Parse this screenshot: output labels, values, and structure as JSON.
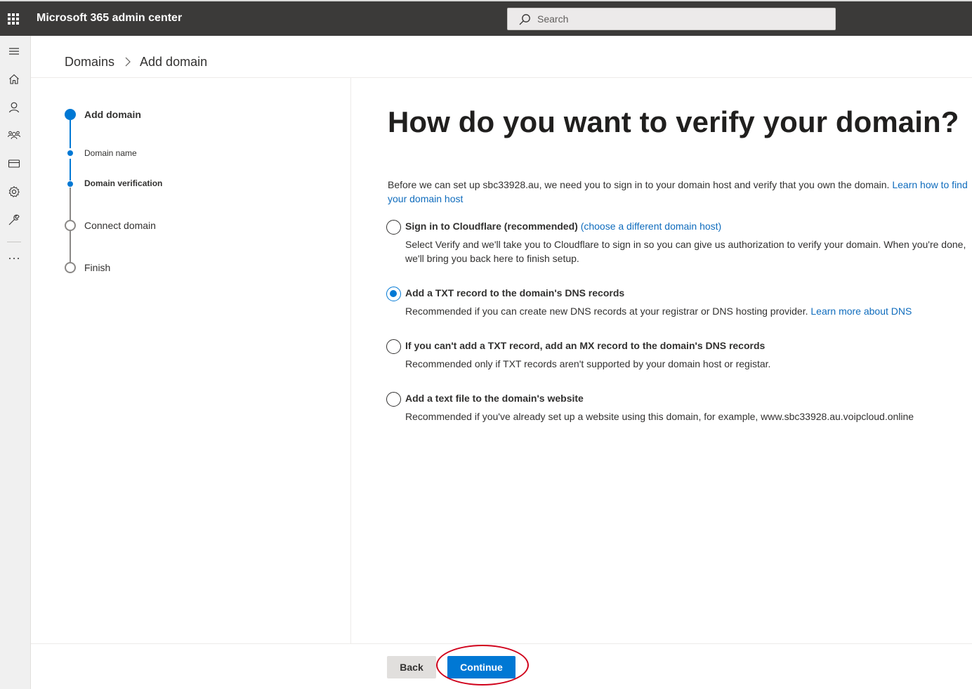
{
  "header": {
    "app_title": "Microsoft 365 admin center",
    "search_placeholder": "Search"
  },
  "leftnav": {
    "icons": [
      "menu-icon",
      "home-icon",
      "user-icon",
      "group-icon",
      "billing-icon",
      "settings-icon",
      "setup-icon",
      "more-icon"
    ]
  },
  "breadcrumb": {
    "parent": "Domains",
    "current": "Add domain"
  },
  "steps": [
    {
      "label": "Add domain",
      "state": "current"
    },
    {
      "label": "Domain name",
      "state": "done"
    },
    {
      "label": "Domain verification",
      "state": "active"
    },
    {
      "label": "Connect domain",
      "state": "pending"
    },
    {
      "label": "Finish",
      "state": "pending"
    }
  ],
  "main": {
    "title": "How do you want to verify your domain?",
    "intro_text": "Before we can set up sbc33928.au, we need you to sign in to your domain host and verify that you own the domain. ",
    "intro_link": "Learn how to find your domain host",
    "options": [
      {
        "title": "Sign in to Cloudflare (recommended)",
        "title_link": "(choose a different domain host)",
        "description": "Select Verify and we'll take you to Cloudflare to sign in so you can give us authorization to verify your domain. When you're done, we'll bring you back here to finish setup.",
        "selected": false
      },
      {
        "title": "Add a TXT record to the domain's DNS records",
        "description": "Recommended if you can create new DNS records at your registrar or DNS hosting provider. ",
        "description_link": "Learn more about DNS",
        "selected": true
      },
      {
        "title": "If you can't add a TXT record, add an MX record to the domain's DNS records",
        "description": "Recommended only if TXT records aren't supported by your domain host or registar.",
        "selected": false
      },
      {
        "title": "Add a text file to the domain's website",
        "description": "Recommended if you've already set up a website using this domain, for example, www.sbc33928.au.voipcloud.online",
        "selected": false
      }
    ]
  },
  "footer": {
    "back_label": "Back",
    "continue_label": "Continue"
  },
  "colors": {
    "accent": "#0078d4",
    "topbar": "#3b3a39",
    "annotation": "#d0021b"
  }
}
